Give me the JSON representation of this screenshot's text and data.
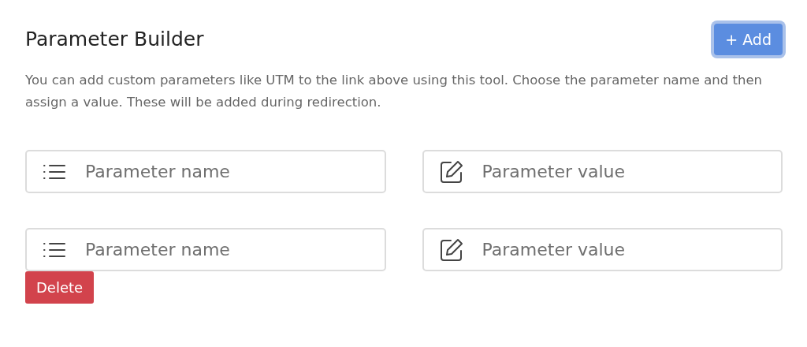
{
  "header": {
    "title": "Parameter Builder",
    "add_button": {
      "label": "+ Add",
      "focused": true
    }
  },
  "description": "You can add custom parameters like UTM to the link above using this tool. Choose the parameter name and then assign a value. These will be added during redirection.",
  "parameters": [
    {
      "name": {
        "placeholder": "Parameter name"
      },
      "value": {
        "placeholder": "Parameter value"
      }
    },
    {
      "name": {
        "placeholder": "Parameter name"
      },
      "value": {
        "placeholder": "Parameter value"
      },
      "delete_button": "Delete"
    }
  ]
}
